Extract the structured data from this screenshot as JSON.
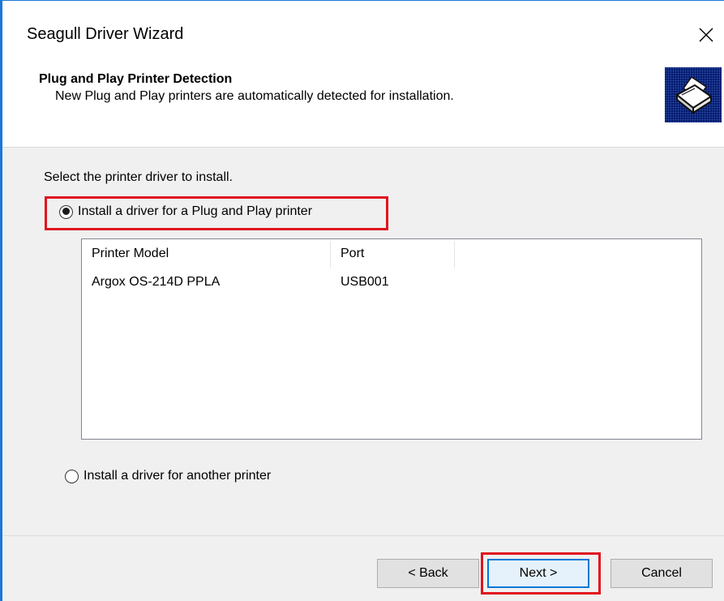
{
  "window": {
    "title": "Seagull Driver Wizard"
  },
  "header": {
    "title": "Plug and Play Printer Detection",
    "subtitle": "New Plug and Play printers are automatically detected for installation.",
    "icon": "printer-icon"
  },
  "content": {
    "prompt": "Select the printer driver to install.",
    "option_pnp": {
      "label": "Install a driver for a Plug and Play printer",
      "selected": true
    },
    "option_other": {
      "label": "Install a driver for another printer",
      "selected": false
    },
    "printer_list": {
      "columns": [
        "Printer Model",
        "Port"
      ],
      "rows": [
        {
          "model": "Argox OS-214D PPLA",
          "port": "USB001"
        }
      ]
    }
  },
  "footer": {
    "back_label": "< Back",
    "next_label": "Next >",
    "cancel_label": "Cancel"
  },
  "colors": {
    "accent": "#0078d7",
    "highlight": "#e0141e",
    "window_border": "#1a78d6",
    "icon_background": "#001a6e"
  }
}
